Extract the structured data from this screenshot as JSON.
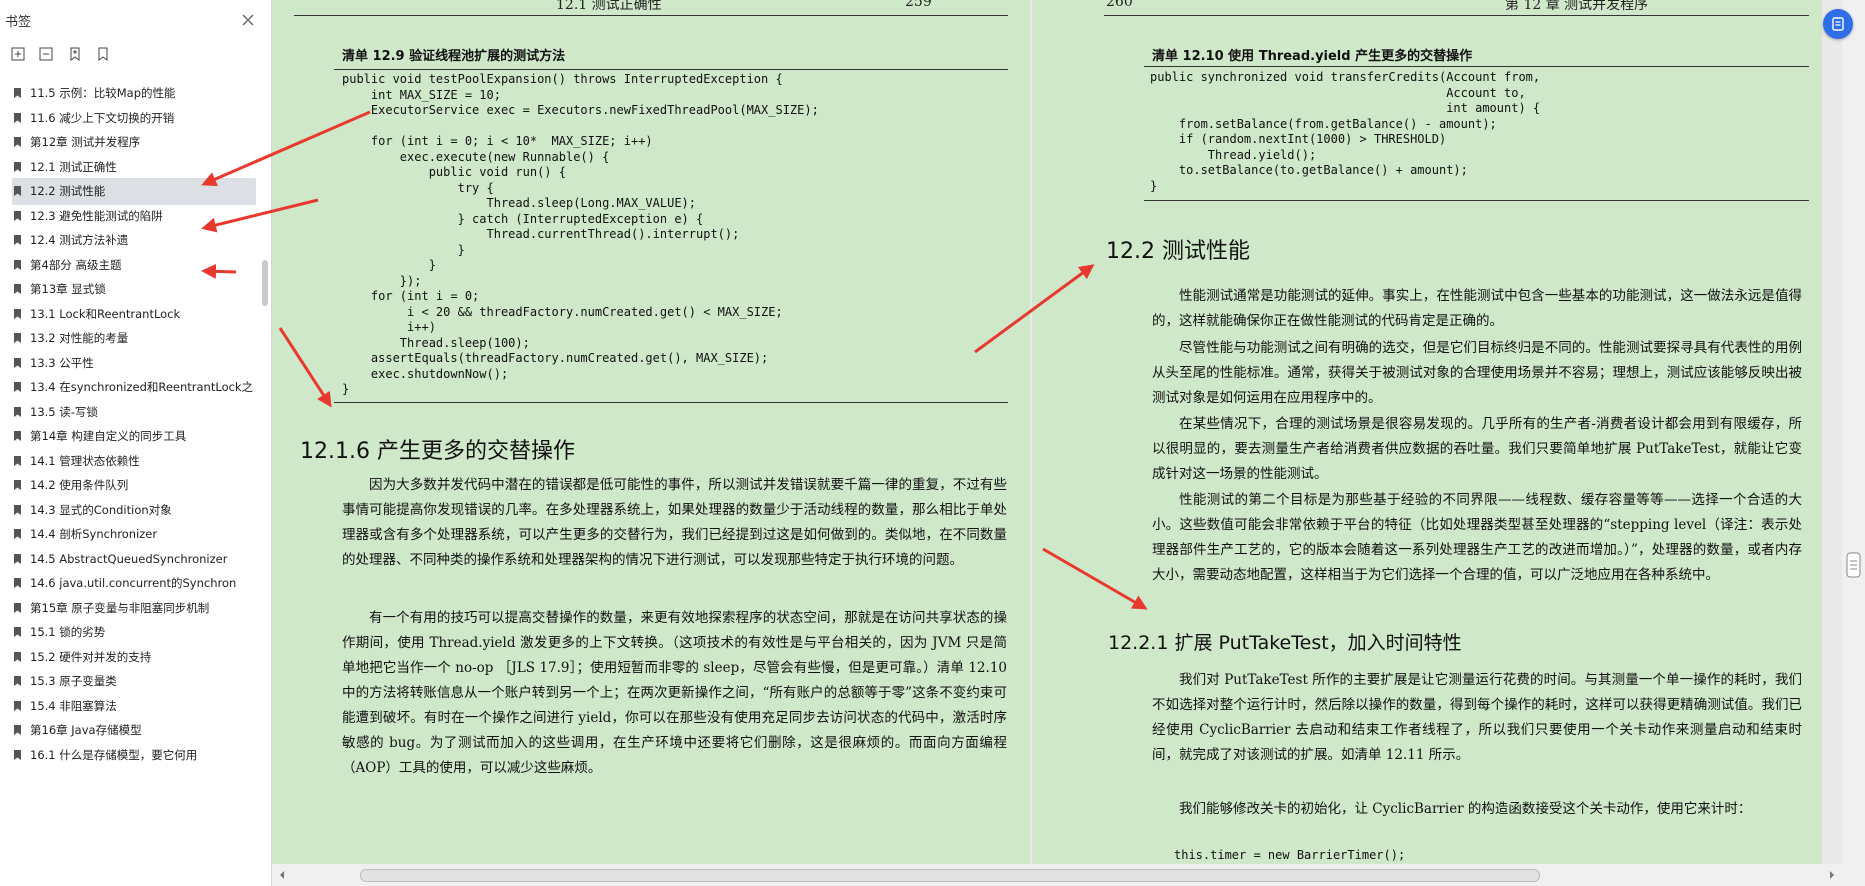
{
  "sidebar": {
    "title": "书签",
    "items": [
      {
        "label": "11.5  示例：比较Map的性能"
      },
      {
        "label": "11.6  减少上下文切换的开销"
      },
      {
        "label": "第12章  测试并发程序"
      },
      {
        "label": "12.1  测试正确性"
      },
      {
        "label": "12.2  测试性能",
        "selected": true
      },
      {
        "label": "12.3  避免性能测试的陷阱"
      },
      {
        "label": "12.4  测试方法补遗"
      },
      {
        "label": "第4部分  高级主题"
      },
      {
        "label": "第13章  显式锁"
      },
      {
        "label": "13.1  Lock和ReentrantLock"
      },
      {
        "label": "13.2  对性能的考量"
      },
      {
        "label": "13.3  公平性"
      },
      {
        "label": "13.4  在synchronized和ReentrantLock之"
      },
      {
        "label": "13.5  读-写锁"
      },
      {
        "label": "第14章  构建自定义的同步工具"
      },
      {
        "label": "14.1  管理状态依赖性"
      },
      {
        "label": "14.2  使用条件队列"
      },
      {
        "label": "14.3  显式的Condition对象"
      },
      {
        "label": "14.4  剖析Synchronizer"
      },
      {
        "label": "14.5  AbstractQueuedSynchronizer"
      },
      {
        "label": "14.6  java.util.concurrent的Synchron"
      },
      {
        "label": "第15章  原子变量与非阻塞同步机制"
      },
      {
        "label": "15.1  锁的劣势"
      },
      {
        "label": "15.2  硬件对并发的支持"
      },
      {
        "label": "15.3  原子变量类"
      },
      {
        "label": "15.4  非阻塞算法"
      },
      {
        "label": "第16章  Java存储模型"
      },
      {
        "label": "16.1  什么是存储模型，要它何用"
      }
    ]
  },
  "left_page": {
    "header_section": "12.1  测试正确性",
    "header_page": "259",
    "listing_title": "清单 12.9   验证线程池扩展的测试方法",
    "code": "public void testPoolExpansion() throws InterruptedException {\n    int MAX_SIZE = 10;\n    ExecutorService exec = Executors.newFixedThreadPool(MAX_SIZE);\n\n    for (int i = 0; i < 10*  MAX_SIZE; i++)\n        exec.execute(new Runnable() {\n            public void run() {\n                try {\n                    Thread.sleep(Long.MAX_VALUE);\n                } catch (InterruptedException e) {\n                    Thread.currentThread().interrupt();\n                }\n            }\n        });\n    for (int i = 0;\n         i < 20 && threadFactory.numCreated.get() < MAX_SIZE;\n         i++)\n        Thread.sleep(100);\n    assertEquals(threadFactory.numCreated.get(), MAX_SIZE);\n    exec.shutdownNow();\n}",
    "heading": "12.1.6   产生更多的交替操作",
    "para1": "因为大多数并发代码中潜在的错误都是低可能性的事件，所以测试并发错误就要千篇一律的重复，不过有些事情可能提高你发现错误的几率。在多处理器系统上，如果处理器的数量少于活动线程的数量，那么相比于单处理器或含有多个处理器系统，可以产生更多的交替行为，我们已经提到过这是如何做到的。类似地，在不同数量的处理器、不同种类的操作系统和处理器架构的情况下进行测试，可以发现那些特定于执行环境的问题。",
    "para2": "有一个有用的技巧可以提高交替操作的数量，来更有效地探索程序的状态空间，那就是在访问共享状态的操作期间，使用 Thread.yield 激发更多的上下文转换。（这项技术的有效性是与平台相关的，因为 JVM 只是简单地把它当作一个 no-op ［JLS 17.9］；使用短暂而非零的 sleep，尽管会有些慢，但是更可靠。）清单 12.10 中的方法将转账信息从一个账户转到另一个上；在两次更新操作之间，“所有账户的总额等于零”这条不变约束可能遭到破坏。有时在一个操作之间进行 yield，你可以在那些没有使用充足同步去访问状态的代码中，激活时序敏感的 bug。为了测试而加入的这些调用，在生产环境中还要将它们删除，这是很麻烦的。而面向方面编程（AOP）工具的使用，可以减少这些麻烦。"
  },
  "right_page": {
    "header_page": "260",
    "header_chapter": "第 12 章   测试并发程序",
    "listing_title": "清单 12.10   使用 Thread.yield 产生更多的交替操作",
    "code": "public synchronized void transferCredits(Account from,\n                                         Account to,\n                                         int amount) {\n    from.setBalance(from.getBalance() - amount);\n    if (random.nextInt(1000) > THRESHOLD)\n        Thread.yield();\n    to.setBalance(to.getBalance() + amount);\n}",
    "heading": "12.2   测试性能",
    "para1": "性能测试通常是功能测试的延伸。事实上，在性能测试中包含一些基本的功能测试，这一做法永远是值得的，这样就能确保你正在做性能测试的代码肯定是正确的。",
    "para2": "尽管性能与功能测试之间有明确的选交，但是它们目标终归是不同的。性能测试要探寻具有代表性的用例从头至尾的性能标准。通常，获得关于被测试对象的合理使用场景并不容易；理想上，测试应该能够反映出被测试对象是如何运用在应用程序中的。",
    "para3": "在某些情况下，合理的测试场景是很容易发现的。几乎所有的生产者-消费者设计都会用到有限缓存，所以很明显的，要去测量生产者给消费者供应数据的吞吐量。我们只要简单地扩展 PutTakeTest，就能让它变成针对这一场景的性能测试。",
    "para4": "性能测试的第二个目标是为那些基于经验的不同界限——线程数、缓存容量等等——选择一个合适的大小。这些数值可能会非常依赖于平台的特征（比如处理器类型甚至处理器的“stepping level（译注：表示处理器部件生产工艺的，它的版本会随着这一系列处理器生产工艺的改进而增加。）”，处理器的数量，或者内存大小，需要动态地配置，这样相当于为它们选择一个合理的值，可以广泛地应用在各种系统中。",
    "subheading": "12.2.1   扩展 PutTakeTest，加入时间特性",
    "para5": "我们对 PutTakeTest 所作的主要扩展是让它测量运行花费的时间。与其测量一个单一操作的耗时，我们不如选择对整个运行计时，然后除以操作的数量，得到每个操作的耗时，这样可以获得更精确测试值。我们已经使用 CyclicBarrier 去启动和结束工作者线程了，所以我们只要使用一个关卡动作来测量启动和结束时间，就完成了对该测试的扩展。如清单 12.11 所示。",
    "para6": "我们能够修改关卡的初始化，让 CyclicBarrier 的构造函数接受这个关卡动作，使用它来计时：",
    "code_tail": "this.timer = new BarrierTimer();"
  },
  "colors": {
    "page_bg": "#cfe8c9",
    "annotation_arrow": "#e8392f",
    "fab": "#2f6ee9"
  },
  "icons": [
    "close-icon",
    "expand-all-icon",
    "collapse-all-icon",
    "add-bookmark-icon",
    "bookmark-icon",
    "fab-icon"
  ]
}
